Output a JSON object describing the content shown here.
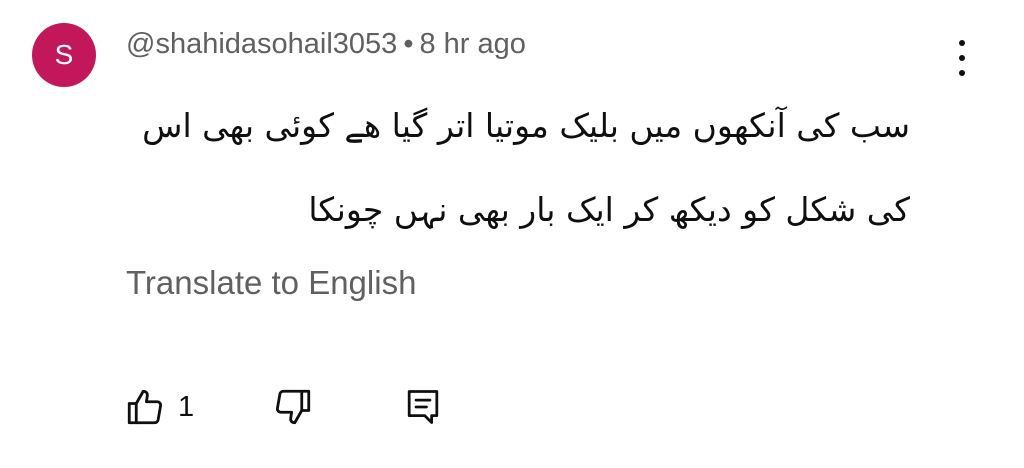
{
  "comment": {
    "avatar_letter": "S",
    "avatar_color": "#c2185b",
    "username": "@shahidasohail3053",
    "separator": "•",
    "time": "8 hr ago",
    "text_line1": "سب کی آنکھوں میں بلیک موتیا اتر گیا ھے کوئی بھی اس",
    "text_line2": "کی شکل کو دیکھ کر ایک بار بھی نہں چونکا",
    "translate_label": "Translate to English",
    "like_count": "1"
  },
  "icons": {
    "like": "thumbs-up-icon",
    "dislike": "thumbs-down-icon",
    "reply": "reply-comment-icon",
    "more": "more-vertical-icon"
  }
}
